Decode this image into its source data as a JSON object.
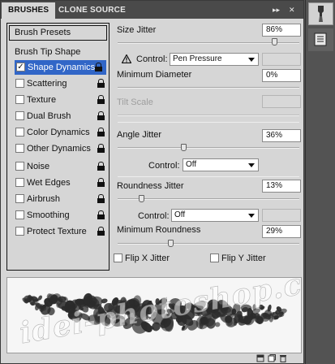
{
  "tabs": [
    "BRUSHES",
    "CLONE SOURCE"
  ],
  "tab_controls": "▸▸ | ✕",
  "menu_glyph": "≡",
  "brush_list": {
    "presets_label": "Brush Presets",
    "tip_shape_label": "Brush Tip Shape",
    "items": [
      {
        "label": "Shape Dynamics",
        "checked": true,
        "selected": true
      },
      {
        "label": "Scattering",
        "checked": false
      },
      {
        "label": "Texture",
        "checked": false
      },
      {
        "label": "Dual Brush",
        "checked": false
      },
      {
        "label": "Color Dynamics",
        "checked": false
      },
      {
        "label": "Other Dynamics",
        "checked": false
      },
      {
        "label": "Noise",
        "checked": false
      },
      {
        "label": "Wet Edges",
        "checked": false
      },
      {
        "label": "Airbrush",
        "checked": false
      },
      {
        "label": "Smoothing",
        "checked": false
      },
      {
        "label": "Protect Texture",
        "checked": false
      }
    ]
  },
  "settings": {
    "size_jitter": {
      "label": "Size Jitter",
      "value": "86%",
      "fraction": 0.86
    },
    "control1": {
      "label": "Control:",
      "value": "Pen Pressure"
    },
    "minimum_diameter": {
      "label": "Minimum Diameter",
      "value": "0%",
      "fraction": 0.0
    },
    "tilt_scale": {
      "label": "Tilt Scale",
      "value": ""
    },
    "angle_jitter": {
      "label": "Angle Jitter",
      "value": "36%",
      "fraction": 0.36
    },
    "control2": {
      "label": "Control:",
      "value": "Off"
    },
    "roundness_jitter": {
      "label": "Roundness Jitter",
      "value": "13%",
      "fraction": 0.13
    },
    "control3": {
      "label": "Control:",
      "value": "Off"
    },
    "minimum_roundness": {
      "label": "Minimum Roundness",
      "value": "29%",
      "fraction": 0.29
    },
    "flip_x": {
      "label": "Flip X Jitter",
      "checked": false
    },
    "flip_y": {
      "label": "Flip Y Jitter",
      "checked": false
    }
  },
  "watermark": {
    "line1": "idei-photoshop.com"
  },
  "colors": {
    "selection": "#3166c7",
    "panel": "#d6d6d6",
    "tabbar": "#4a4a4a"
  }
}
